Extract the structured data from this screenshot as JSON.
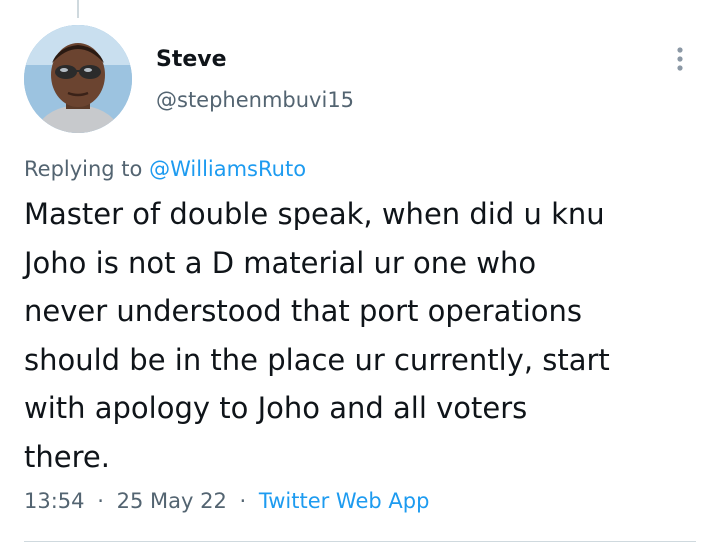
{
  "tweet": {
    "author": {
      "display_name": "Steve",
      "handle": "@stephenmbuvi15"
    },
    "more_icon": "three-dots-vertical-icon",
    "reply": {
      "prefix": "Replying to",
      "mention": "@WilliamsRuto"
    },
    "text_lines": [
      "Master of double speak, when did u knu",
      "Joho is not a D material ur one who",
      "never understood that port operations",
      "should be in the place ur currently, start",
      "with apology to Joho and all voters",
      "there."
    ],
    "time": "13:54",
    "separator": "·",
    "date": "25 May 22",
    "source": "Twitter Web App"
  },
  "colors": {
    "text_primary": "#0f1419",
    "text_secondary": "#536471",
    "link": "#1d9bf0",
    "border": "#cfd9de"
  }
}
